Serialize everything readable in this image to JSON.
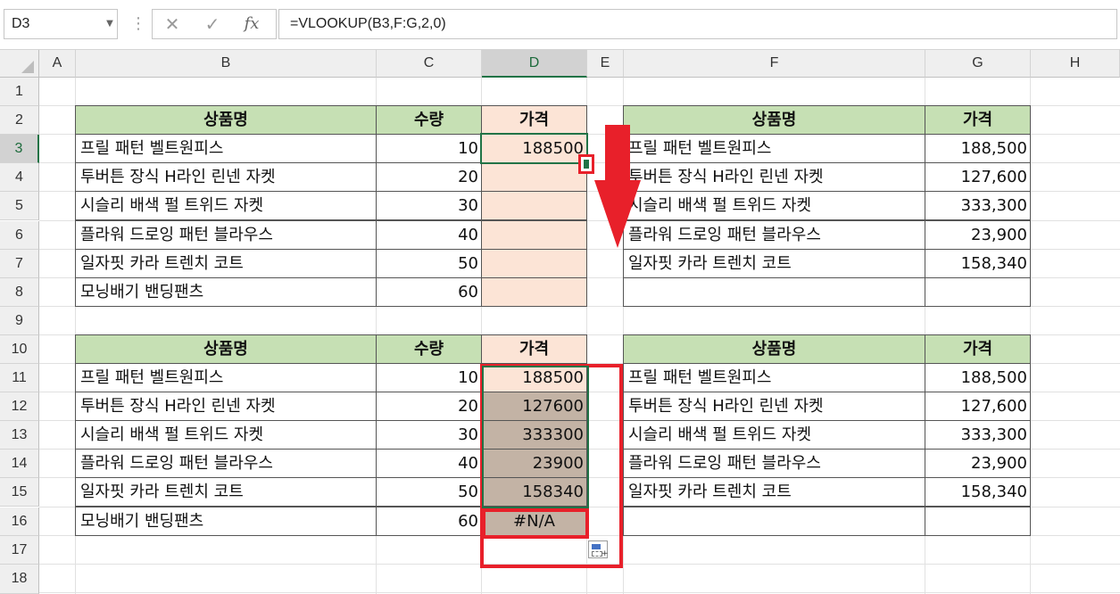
{
  "formula_bar": {
    "name_box": "D3",
    "cancel_icon": "✕",
    "enter_icon": "✓",
    "fx_label": "fx",
    "formula": "=VLOOKUP(B3,F:G,2,0)"
  },
  "columns": [
    "A",
    "B",
    "C",
    "D",
    "E",
    "F",
    "G",
    "H"
  ],
  "rows": [
    "1",
    "2",
    "3",
    "4",
    "5",
    "6",
    "7",
    "8",
    "9",
    "10",
    "11",
    "12",
    "13",
    "14",
    "15",
    "16",
    "17",
    "18"
  ],
  "selected_cell": {
    "column": "D",
    "row": "3"
  },
  "table_headers": {
    "product": "상품명",
    "qty": "수량",
    "price": "가격"
  },
  "top_left_table": [
    {
      "product": "프릴 패턴 벨트원피스",
      "qty": "10",
      "price": "188500"
    },
    {
      "product": "투버튼 장식 H라인 린넨 자켓",
      "qty": "20",
      "price": ""
    },
    {
      "product": "시슬리 배색 펄 트위드 자켓",
      "qty": "30",
      "price": ""
    },
    {
      "product": "플라워 드로잉 패턴 블라우스",
      "qty": "40",
      "price": ""
    },
    {
      "product": "일자핏 카라 트렌치 코트",
      "qty": "50",
      "price": ""
    },
    {
      "product": "모닝배기 밴딩팬츠",
      "qty": "60",
      "price": ""
    }
  ],
  "top_right_table": [
    {
      "product": "프릴 패턴 벨트원피스",
      "price": "188,500"
    },
    {
      "product": "투버튼 장식 H라인 린넨 자켓",
      "price": "127,600"
    },
    {
      "product": "시슬리 배색 펄 트위드 자켓",
      "price": "333,300"
    },
    {
      "product": "플라워 드로잉 패턴 블라우스",
      "price": "23,900"
    },
    {
      "product": "일자핏 카라 트렌치 코트",
      "price": "158,340"
    },
    {
      "product": "",
      "price": ""
    }
  ],
  "bottom_left_table": [
    {
      "product": "프릴 패턴 벨트원피스",
      "qty": "10",
      "price": "188500"
    },
    {
      "product": "투버튼 장식 H라인 린넨 자켓",
      "qty": "20",
      "price": "127600"
    },
    {
      "product": "시슬리 배색 펄 트위드 자켓",
      "qty": "30",
      "price": "333300"
    },
    {
      "product": "플라워 드로잉 패턴 블라우스",
      "qty": "40",
      "price": "23900"
    },
    {
      "product": "일자핏 카라 트렌치 코트",
      "qty": "50",
      "price": "158340"
    },
    {
      "product": "모닝배기 밴딩팬츠",
      "qty": "60",
      "price": "#N/A"
    }
  ],
  "bottom_right_table": [
    {
      "product": "프릴 패턴 벨트원피스",
      "price": "188,500"
    },
    {
      "product": "투버튼 장식 H라인 린넨 자켓",
      "price": "127,600"
    },
    {
      "product": "시슬리 배색 펄 트위드 자켓",
      "price": "333,300"
    },
    {
      "product": "플라워 드로잉 패턴 블라우스",
      "price": "23,900"
    },
    {
      "product": "일자핏 카라 트렌치 코트",
      "price": "158,340"
    },
    {
      "product": "",
      "price": ""
    }
  ],
  "colors": {
    "header_green": "#c6e0b4",
    "price_pink": "#fce4d6",
    "filled_tan": "#c3b3a5",
    "annotation_red": "#e8202a",
    "excel_green": "#217346"
  },
  "icons": {
    "fill_handle": "fill-handle-icon",
    "drag_arrow": "down-arrow-icon",
    "autofill_options": "autofill-options-icon"
  }
}
